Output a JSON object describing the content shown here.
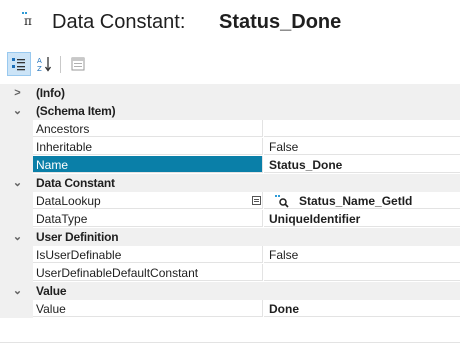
{
  "header": {
    "icon": "data-constant-icon",
    "title_prefix": "Data Constant:",
    "title_name": "Status_Done"
  },
  "toolbar": {
    "buttons": [
      {
        "name": "categorized-view",
        "icon": "categorized-icon",
        "active": true
      },
      {
        "name": "alphabetical-view",
        "icon": "sort-az-icon",
        "active": false
      },
      {
        "name": "property-pages",
        "icon": "property-pages-icon",
        "active": false
      }
    ]
  },
  "grid": {
    "rows": [
      {
        "kind": "category",
        "label": "(Info)",
        "expanded": false
      },
      {
        "kind": "category",
        "label": "(Schema Item)",
        "expanded": true
      },
      {
        "kind": "property",
        "name": "Ancestors",
        "value": ""
      },
      {
        "kind": "property",
        "name": "Inheritable",
        "value": "False"
      },
      {
        "kind": "property",
        "name": "Name",
        "value": "Status_Done",
        "selected": true,
        "bold": true
      },
      {
        "kind": "category",
        "label": "Data Constant",
        "expanded": true
      },
      {
        "kind": "property",
        "name": "DataLookup",
        "value": "Status_Name_GetId",
        "lookup": true
      },
      {
        "kind": "property",
        "name": "DataType",
        "value": "UniqueIdentifier",
        "bold": true
      },
      {
        "kind": "category",
        "label": "User Definition",
        "expanded": true
      },
      {
        "kind": "property",
        "name": "IsUserDefinable",
        "value": "False"
      },
      {
        "kind": "property",
        "name": "UserDefinableDefaultConstant",
        "value": ""
      },
      {
        "kind": "category",
        "label": "Value",
        "expanded": true
      },
      {
        "kind": "property",
        "name": "Value",
        "value": "Done",
        "bold": true
      }
    ]
  },
  "colors": {
    "selection": "#0a7fa8",
    "category_bg": "#f0f0f0",
    "grid_line": "#e3e3e3"
  }
}
